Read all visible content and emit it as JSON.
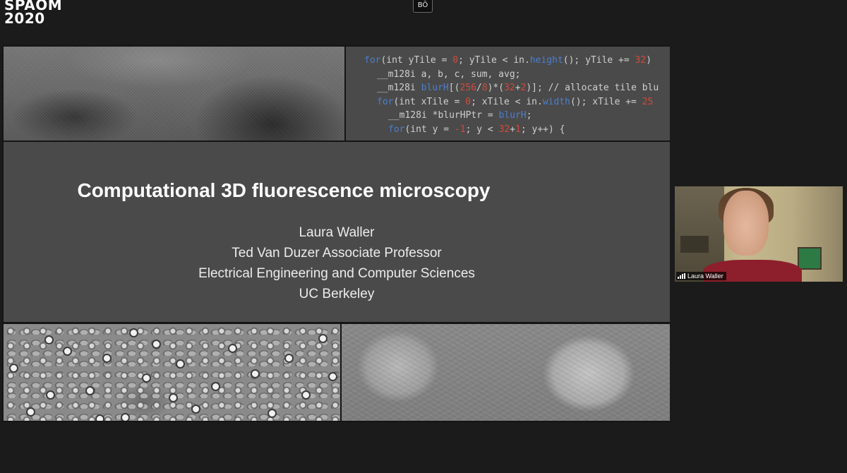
{
  "logo": {
    "line1": "SPAOM",
    "line2": "2020"
  },
  "top_badge": {
    "text": "BŌ"
  },
  "slide": {
    "code_lines": [
      [
        [
          "kw",
          "for"
        ],
        [
          "txt",
          " (int yTile = "
        ],
        [
          "num",
          "0"
        ],
        [
          "txt",
          "; yTile < in."
        ],
        [
          "fn",
          "height"
        ],
        [
          "txt",
          "(); yTile += "
        ],
        [
          "num",
          "32"
        ],
        [
          "txt",
          ")"
        ]
      ],
      [
        [
          "txt",
          "  __m128i a, b, c, sum, avg;"
        ]
      ],
      [
        [
          "txt",
          "  __m128i "
        ],
        [
          "fn",
          "blurH"
        ],
        [
          "txt",
          "[("
        ],
        [
          "num",
          "256"
        ],
        [
          "txt",
          "/"
        ],
        [
          "num",
          "8"
        ],
        [
          "txt",
          ")*("
        ],
        [
          "num",
          "32"
        ],
        [
          "txt",
          "+"
        ],
        [
          "num",
          "2"
        ],
        [
          "txt",
          ")]; // allocate tile blu"
        ]
      ],
      [
        [
          "txt",
          "  "
        ],
        [
          "kw",
          "for"
        ],
        [
          "txt",
          " (int xTile = "
        ],
        [
          "num",
          "0"
        ],
        [
          "txt",
          "; xTile < in."
        ],
        [
          "fn",
          "width"
        ],
        [
          "txt",
          "(); xTile += "
        ],
        [
          "num",
          "25"
        ]
      ],
      [
        [
          "txt",
          "    __m128i *blurHPtr = "
        ],
        [
          "fn",
          "blurH"
        ],
        [
          "txt",
          ";"
        ]
      ],
      [
        [
          "txt",
          "    "
        ],
        [
          "kw",
          "for"
        ],
        [
          "txt",
          " (int y = "
        ],
        [
          "num",
          "-1"
        ],
        [
          "txt",
          "; y < "
        ],
        [
          "num",
          "32"
        ],
        [
          "txt",
          "+"
        ],
        [
          "num",
          "1"
        ],
        [
          "txt",
          "; y++) {"
        ]
      ]
    ],
    "title": "Computational 3D fluorescence microscopy",
    "author": "Laura Waller",
    "position": "Ted Van Duzer Associate Professor",
    "department": "Electrical Engineering and Computer Sciences",
    "institution": "UC Berkeley"
  },
  "video": {
    "participant_name": "Laura Waller",
    "signal_icon": "signal-bars-icon"
  }
}
